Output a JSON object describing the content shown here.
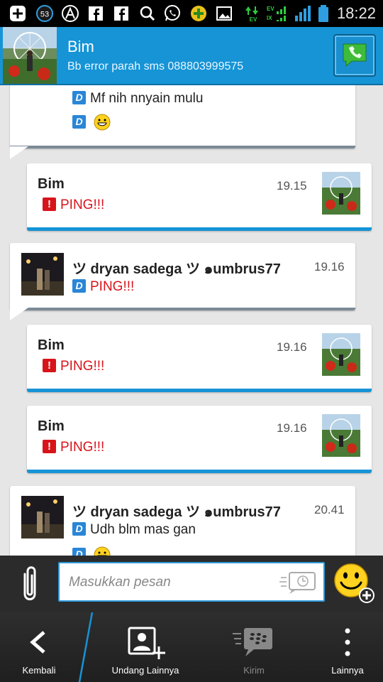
{
  "status_bar": {
    "notification_count": "53",
    "time": "18:22",
    "net_label_1": "EV",
    "net_label_2": "EV",
    "net_label_3": "IX"
  },
  "header": {
    "name": "Bim",
    "status": "Bb error parah sms 088803999575"
  },
  "messages": [
    {
      "lines": [
        "Mf nih nnyain mulu"
      ],
      "has_emoji_line": true
    },
    {
      "sender": "Bim",
      "time": "19.15",
      "text": "PING!!!"
    },
    {
      "sender": "ツ dryan sadega ツ ๑umbrus77",
      "time": "19.16",
      "text": "PING!!!"
    },
    {
      "sender": "Bim",
      "time": "19.16",
      "text": "PING!!!"
    },
    {
      "sender": "Bim",
      "time": "19.16",
      "text": "PING!!!"
    },
    {
      "sender": "ツ dryan sadega ツ ๑umbrus77",
      "time": "20.41",
      "text": "Udh blm mas gan"
    }
  ],
  "input": {
    "placeholder": "Masukkan pesan"
  },
  "nav": {
    "back": "Kembali",
    "invite": "Undang Lainnya",
    "send": "Kirim",
    "more": "Lainnya"
  },
  "colors": {
    "accent": "#1694d6",
    "ping": "#d8141b",
    "status_bar": "#000000"
  }
}
